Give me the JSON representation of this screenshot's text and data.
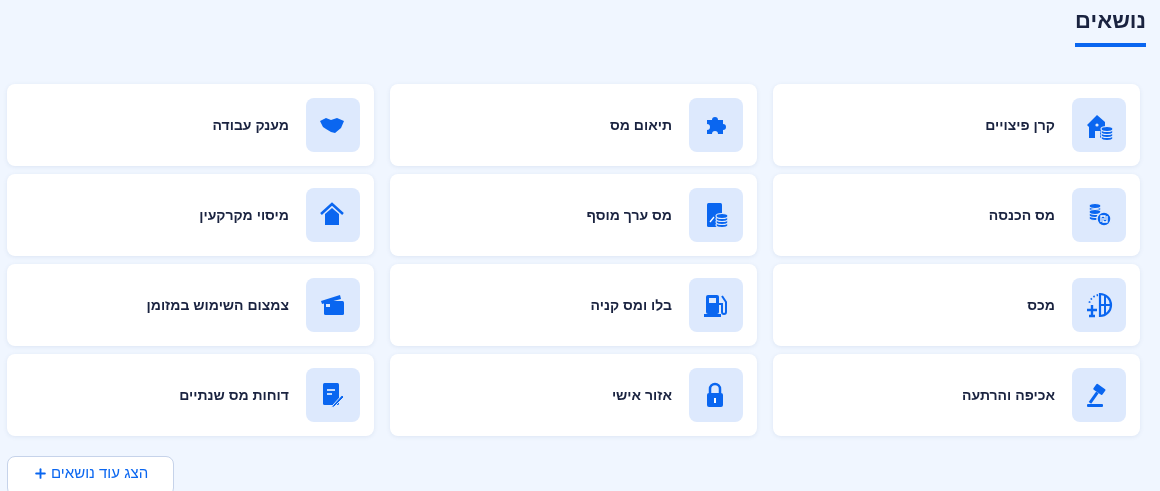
{
  "title": "נושאים",
  "topics": [
    {
      "label": "קרן פיצויים"
    },
    {
      "label": "תיאום מס"
    },
    {
      "label": "מענק עבודה"
    },
    {
      "label": "מס הכנסה"
    },
    {
      "label": "מס ערך מוסף"
    },
    {
      "label": "מיסוי מקרקעין"
    },
    {
      "label": "מכס"
    },
    {
      "label": "בלו ומס קניה"
    },
    {
      "label": "צמצום השימוש במזומן"
    },
    {
      "label": "אכיפה והרתעה"
    },
    {
      "label": "אזור אישי"
    },
    {
      "label": "דוחות מס שנתיים"
    }
  ],
  "more_button": {
    "label": "הצג עוד נושאים"
  }
}
